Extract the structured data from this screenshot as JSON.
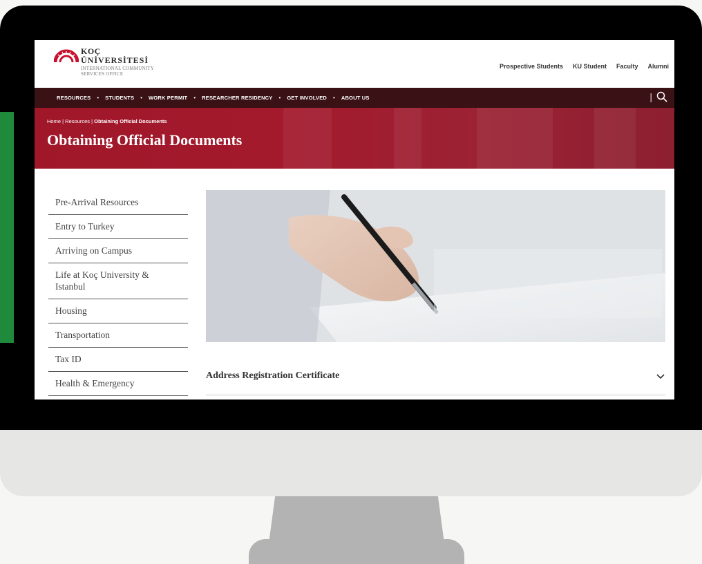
{
  "logo": {
    "line1": "KOÇ",
    "line2": "ÜNİVERSİTESİ",
    "line3": "INTERNATIONAL COMMUNITY",
    "line4": "SERVICES OFFICE",
    "brand_color": "#c8102e"
  },
  "top_links": [
    "Prospective Students",
    "KU Student",
    "Faculty",
    "Alumni"
  ],
  "nav": {
    "items": [
      "RESOURCES",
      "STUDENTS",
      "WORK PERMIT",
      "RESEARCHER RESIDENCY",
      "GET INVOLVED",
      "ABOUT US"
    ],
    "separator": "•",
    "divider": "|",
    "search_icon": "search-icon",
    "background": "#3a1216"
  },
  "hero": {
    "breadcrumb": [
      "Home",
      "Resources",
      "Obtaining Official Documents"
    ],
    "breadcrumb_sep": "|",
    "title": "Obtaining Official Documents",
    "color": "#a0172a"
  },
  "sidebar": {
    "items": [
      "Pre-Arrival Resources",
      "Entry to Turkey",
      "Arriving on Campus",
      "Life at Koç University & Istanbul",
      "Housing",
      "Transportation",
      "Tax ID",
      "Health & Emergency"
    ]
  },
  "main": {
    "image_icon": "photo-hand-signing-document",
    "accordion_title": "Address Registration Certificate",
    "accordion_icon": "chevron-down-icon"
  },
  "accent_green": "#1f8a3b"
}
